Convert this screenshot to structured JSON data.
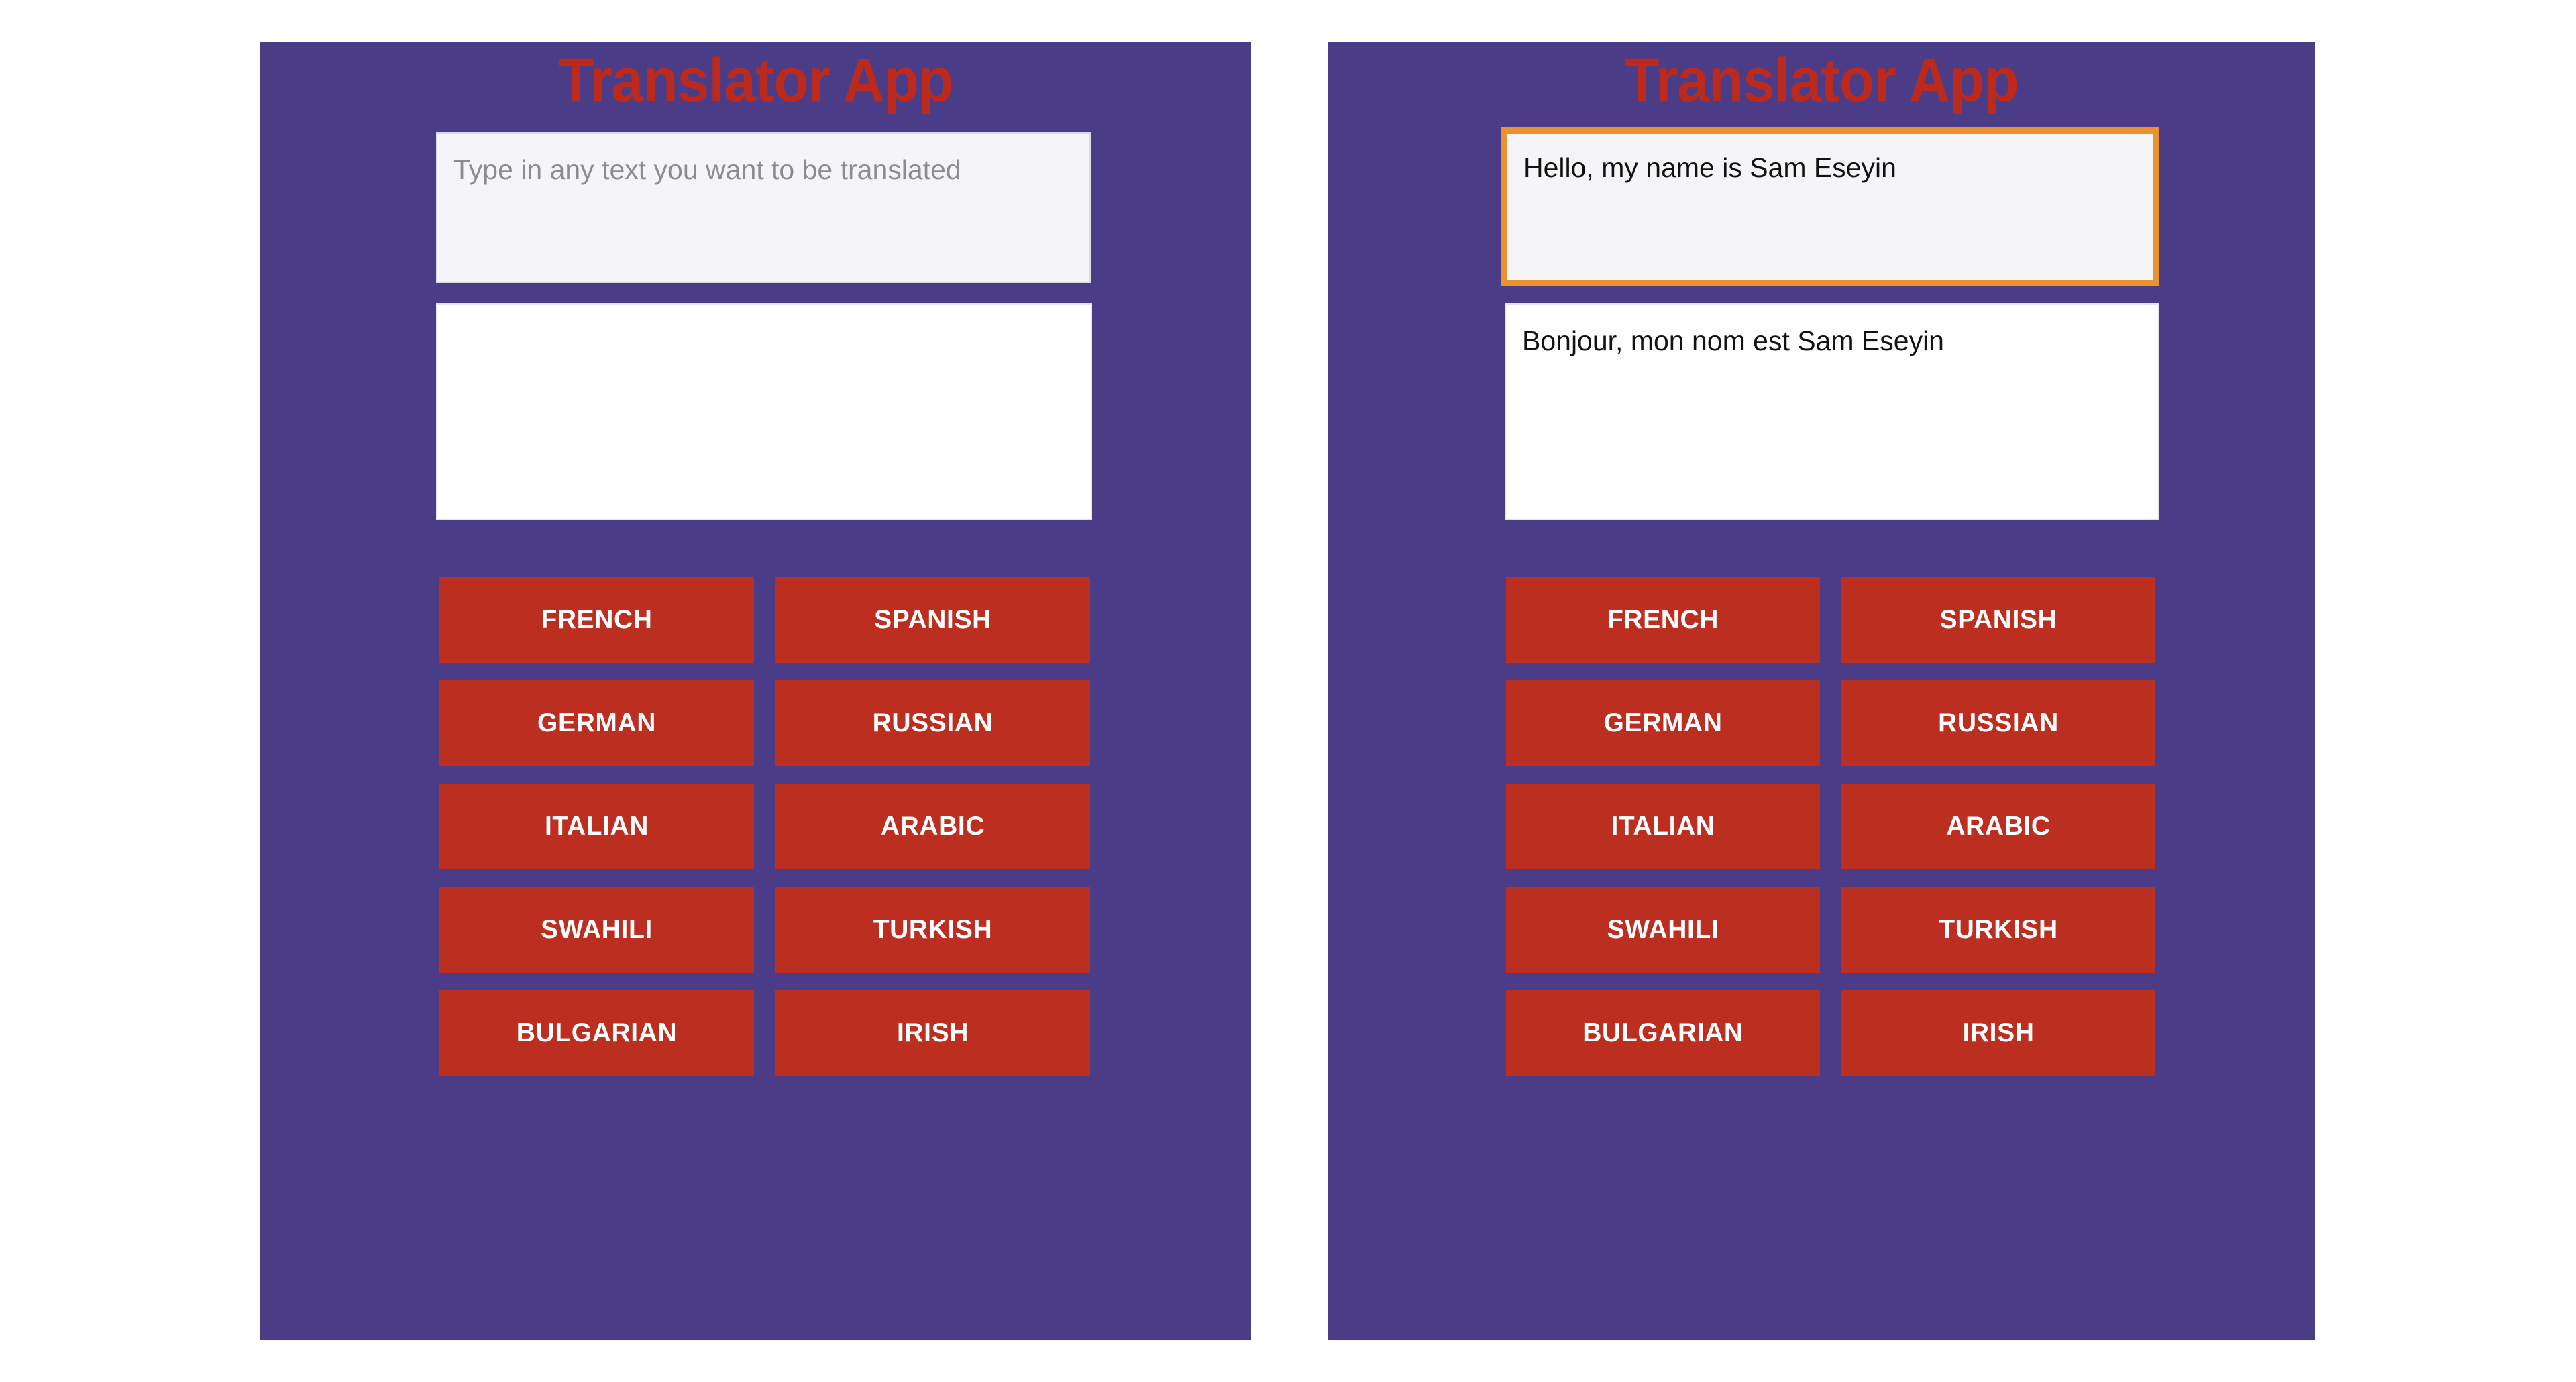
{
  "app": {
    "title": "Translator App",
    "brand_colors": {
      "panel_background": "#4b3c87",
      "title_red": "#bb2a1c",
      "button_red": "#bb2e20",
      "focus_orange": "#e8932f",
      "button_text": "#ffffff",
      "placeholder_gray": "#8c8c90",
      "input_background": "#f5f5f8",
      "output_background": "#ffffff",
      "page_background": "#ffffff"
    }
  },
  "languages": [
    {
      "label": "FRENCH"
    },
    {
      "label": "SPANISH"
    },
    {
      "label": "GERMAN"
    },
    {
      "label": "RUSSIAN"
    },
    {
      "label": "ITALIAN"
    },
    {
      "label": "ARABIC"
    },
    {
      "label": "SWAHILI"
    },
    {
      "label": "TURKISH"
    },
    {
      "label": "BULGARIAN"
    },
    {
      "label": "IRISH"
    }
  ],
  "screens": [
    {
      "id": "empty-state",
      "title": "Translator App",
      "input": {
        "value": "",
        "placeholder": "Type in any text you want to be translated",
        "focused": false
      },
      "output": {
        "value": ""
      }
    },
    {
      "id": "translated-state",
      "title": "Translator App",
      "input": {
        "value": "Hello, my name is Sam Eseyin",
        "placeholder": "Type in any text you want to be translated",
        "focused": true
      },
      "output": {
        "value": "Bonjour, mon nom est Sam Eseyin"
      }
    }
  ]
}
